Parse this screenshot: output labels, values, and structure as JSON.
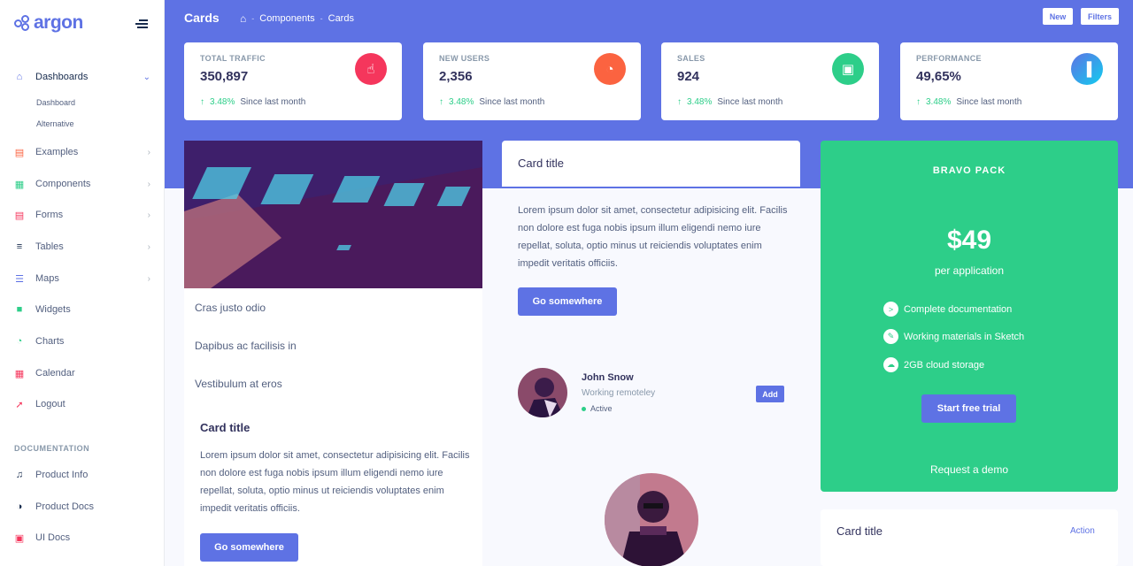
{
  "brand": {
    "name": "argon"
  },
  "sidebar": {
    "items": [
      {
        "label": "Dashboards",
        "icon": "home-icon"
      },
      {
        "label": "Examples",
        "icon": "ship-icon"
      },
      {
        "label": "Components",
        "icon": "components-icon"
      },
      {
        "label": "Forms",
        "icon": "forms-icon"
      },
      {
        "label": "Tables",
        "icon": "list-icon"
      },
      {
        "label": "Maps",
        "icon": "map-icon"
      },
      {
        "label": "Widgets",
        "icon": "archive-icon"
      },
      {
        "label": "Charts",
        "icon": "pie-icon"
      },
      {
        "label": "Calendar",
        "icon": "calendar-icon"
      },
      {
        "label": "Logout",
        "icon": "logout-icon"
      }
    ],
    "subitems": [
      "Dashboard",
      "Alternative"
    ],
    "doc_heading": "DOCUMENTATION",
    "docs": [
      {
        "label": "Product Info",
        "icon": "music-icon"
      },
      {
        "label": "Product Docs",
        "icon": "palette-icon"
      },
      {
        "label": "UI Docs",
        "icon": "ui-icon"
      }
    ]
  },
  "header": {
    "title": "Cards",
    "breadcrumb": [
      "Components",
      "Cards"
    ],
    "buttons": [
      "New",
      "Filters"
    ]
  },
  "stats": [
    {
      "label": "TOTAL TRAFFIC",
      "value": "350,897",
      "change": "3.48%",
      "since": "Since last month",
      "color": "#f5365c"
    },
    {
      "label": "NEW USERS",
      "value": "2,356",
      "change": "3.48%",
      "since": "Since last month",
      "color": "#fb6340"
    },
    {
      "label": "SALES",
      "value": "924",
      "change": "3.48%",
      "since": "Since last month",
      "color": "#2dce89"
    },
    {
      "label": "PERFORMANCE",
      "value": "49,65%",
      "change": "3.48%",
      "since": "Since last month",
      "color": "#5e72e4"
    }
  ],
  "list_card": {
    "items": [
      "Cras justo odio",
      "Dapibus ac facilisis in",
      "Vestibulum at eros"
    ],
    "title": "Card title",
    "text": "Lorem ipsum dolor sit amet, consectetur adipisicing elit. Facilis non dolore est fuga nobis ipsum illum eligendi nemo iure repellat, soluta, optio minus ut reiciendis voluptates enim impedit veritatis officiis.",
    "button": "Go somewhere"
  },
  "middle_card": {
    "title": "Card title",
    "text": "Lorem ipsum dolor sit amet, consectetur adipisicing elit. Facilis non dolore est fuga nobis ipsum illum eligendi nemo iure repellat, soluta, optio minus ut reiciendis voluptates enim impedit veritatis officiis.",
    "button": "Go somewhere"
  },
  "profile": {
    "name": "John Snow",
    "subtitle": "Working remoteley",
    "status": "Active",
    "button": "Add"
  },
  "pricing": {
    "title": "BRAVO PACK",
    "price": "$49",
    "per": "per application",
    "features": [
      "Complete documentation",
      "Working materials in Sketch",
      "2GB cloud storage"
    ],
    "button": "Start free trial",
    "link": "Request a demo"
  },
  "bottom_card": {
    "title": "Card title",
    "action": "Action"
  }
}
